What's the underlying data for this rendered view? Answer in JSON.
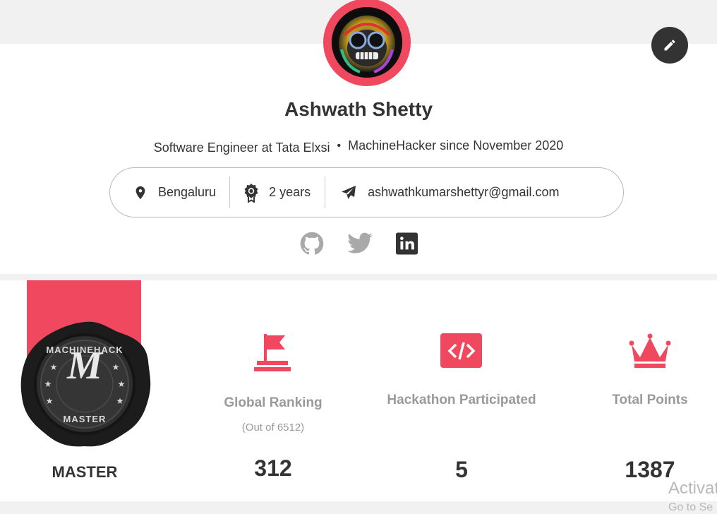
{
  "profile": {
    "name": "Ashwath Shetty",
    "role": "Software Engineer at Tata Elxsi",
    "separator": "•",
    "member_since": "MachineHacker since November 2020",
    "location": "Bengaluru",
    "experience": "2 years",
    "email": "ashwathkumarshettyr@gmail.com",
    "icons": {
      "location": "map-pin-icon",
      "experience": "award-badge-icon",
      "email": "paper-plane-icon",
      "edit": "pencil-icon"
    }
  },
  "socials": [
    {
      "name": "github",
      "icon": "github-icon"
    },
    {
      "name": "twitter",
      "icon": "twitter-icon"
    },
    {
      "name": "linkedin",
      "icon": "linkedin-icon"
    }
  ],
  "badge": {
    "seal_top_text": "MACHINEHACK",
    "seal_letter": "M",
    "seal_bottom_text": "MASTER",
    "label": "MASTER"
  },
  "stats": {
    "ranking": {
      "label": "Global Ranking",
      "sub": "(Out of 6512)",
      "value": "312",
      "icon": "flag-icon"
    },
    "hackathons": {
      "label": "Hackathon Participated",
      "value": "5",
      "icon": "code-icon"
    },
    "points": {
      "label": "Total Points",
      "value": "1387",
      "icon": "crown-icon"
    }
  },
  "watermark": {
    "line1": "Activate",
    "line2": "Go to Se"
  },
  "colors": {
    "accent": "#f0485f",
    "text": "#333333",
    "muted": "#9a9a9a",
    "background": "#f1f1f1"
  }
}
